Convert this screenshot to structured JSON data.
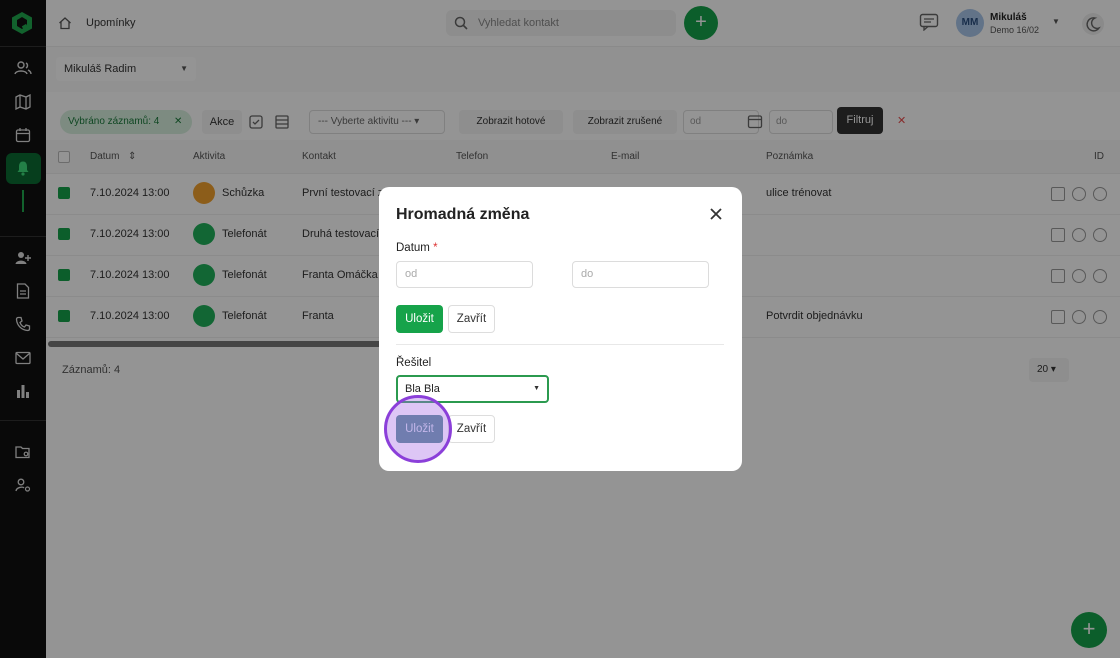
{
  "colors": {
    "accent": "#16a34a",
    "sidebar_bg": "#111111",
    "click_ring": "#8b3fd9",
    "danger": "#e84b4b"
  },
  "header": {
    "breadcrumb": "Upomínky",
    "search_placeholder": "Vyhledat kontakt",
    "user_initials": "MM",
    "user_name": "Mikuláš",
    "user_sub": "Demo 16/02"
  },
  "filters": {
    "user_select": "Mikuláš Radim",
    "chip": "Vybráno záznamů: 4",
    "akce": "Akce",
    "activity_select": "--- Vyberte aktivitu ---",
    "show_done": "Zobrazit hotové",
    "show_undone": "Zobrazit zrušené",
    "from": "od",
    "to": "do",
    "filter_button": "Filtruj",
    "clear": "✕"
  },
  "table": {
    "columns": [
      "Datum",
      "Aktivita",
      "Kontakt",
      "Telefon",
      "E-mail",
      "Poznámka",
      "ID"
    ],
    "rows": [
      {
        "date": "7.10.2024 13:00",
        "activity": "Schůzka",
        "contact": "První testovací z",
        "note": "ulice trénovat"
      },
      {
        "date": "7.10.2024 13:00",
        "activity": "Telefonát",
        "contact": "Druhá testovací",
        "note": ""
      },
      {
        "date": "7.10.2024 13:00",
        "activity": "Telefonát",
        "contact": "Franta Omáčka",
        "note": ""
      },
      {
        "date": "7.10.2024 13:00",
        "activity": "Telefonát",
        "contact": "Franta",
        "note": "Potvrdit objednávku"
      }
    ],
    "footer": "Záznamů: 4",
    "page_size": "20"
  },
  "modal": {
    "title": "Hromadná změna",
    "date_label": "Datum",
    "required_mark": "*",
    "from_placeholder": "od",
    "to_placeholder": "do",
    "save": "Uložit",
    "close": "Zavřít",
    "solver_label": "Řešitel",
    "solver_value": "Bla Bla"
  }
}
